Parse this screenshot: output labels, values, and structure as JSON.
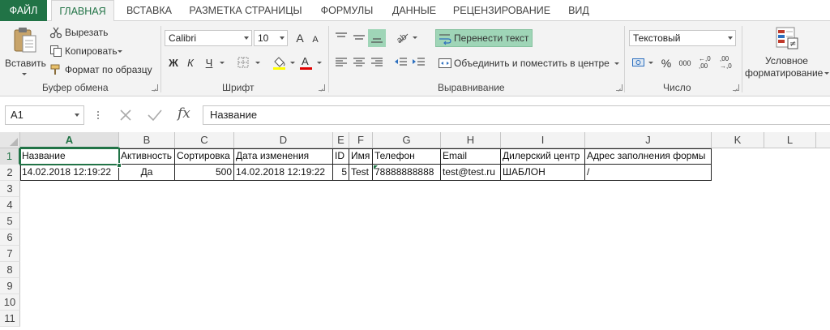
{
  "tabs": [
    {
      "label": "ФАЙЛ"
    },
    {
      "label": "ГЛАВНАЯ"
    },
    {
      "label": "ВСТАВКА"
    },
    {
      "label": "РАЗМЕТКА СТРАНИЦЫ"
    },
    {
      "label": "ФОРМУЛЫ"
    },
    {
      "label": "ДАННЫЕ"
    },
    {
      "label": "РЕЦЕНЗИРОВАНИЕ"
    },
    {
      "label": "ВИД"
    }
  ],
  "ribbon": {
    "clipboard": {
      "paste": "Вставить",
      "cut": "Вырезать",
      "copy": "Копировать",
      "format_painter": "Формат по образцу",
      "title": "Буфер обмена"
    },
    "font": {
      "name": "Calibri",
      "size": "10",
      "bold": "Ж",
      "italic": "К",
      "underline": "Ч",
      "grow": "A",
      "shrink": "A",
      "title": "Шрифт"
    },
    "alignment": {
      "wrap_text": "Перенести текст",
      "merge_center": "Объединить и поместить в центре",
      "title": "Выравнивание"
    },
    "number": {
      "format": "Текстовый",
      "percent": "%",
      "thousands": "000",
      "inc_decimal_top": "←,0",
      "inc_decimal_bottom": ",00",
      "dec_decimal_top": ",00",
      "dec_decimal_bottom": "→,0",
      "title": "Число"
    },
    "styles": {
      "conditional_line1": "Условное",
      "conditional_line2": "форматирование"
    }
  },
  "formula_bar": {
    "name_box": "A1",
    "fx": "fx",
    "value": "Название"
  },
  "sheet": {
    "columns": [
      "A",
      "B",
      "C",
      "D",
      "E",
      "F",
      "G",
      "H",
      "I",
      "J",
      "K",
      "L"
    ],
    "rows": [
      "1",
      "2",
      "3",
      "4",
      "5",
      "6",
      "7",
      "8",
      "9",
      "10",
      "11"
    ],
    "header_row": [
      "Название",
      "Активность",
      "Сортировка",
      "Дата изменения",
      "ID",
      "Имя",
      "Телефон",
      "Email",
      "Дилерский центр",
      "Адрес заполнения формы"
    ],
    "data_row": [
      "14.02.2018 12:19:22",
      "Да",
      "500",
      "14.02.2018 12:19:22",
      "5",
      "Test",
      "78888888888",
      "test@test.ru",
      "ШАБЛОН",
      "/"
    ],
    "active_cell": "A1"
  },
  "colors": {
    "accent": "#217346",
    "wrap_highlight": "#9fd5b7",
    "ribbon_bg": "#f3f3f3"
  }
}
